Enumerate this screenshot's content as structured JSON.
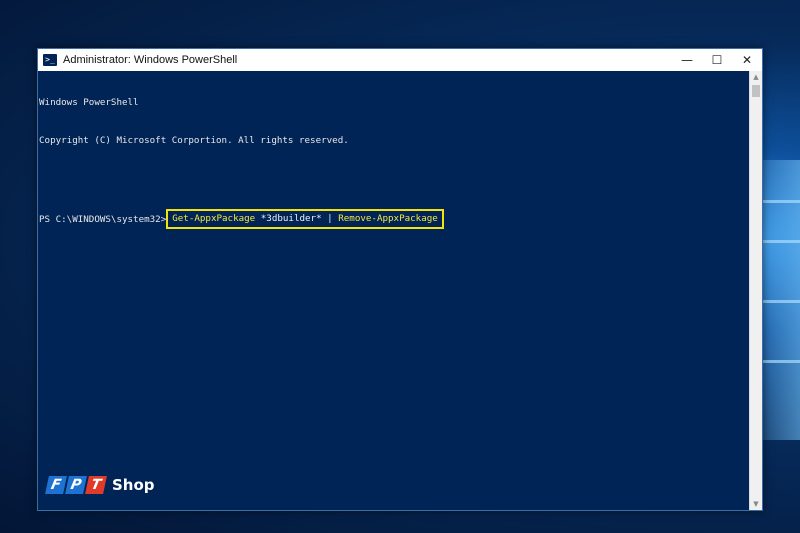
{
  "window": {
    "title": "Administrator: Windows PowerShell",
    "icon": "powershell-icon",
    "minimize_glyph": "—",
    "maximize_glyph": "☐",
    "close_glyph": "✕"
  },
  "console": {
    "line1": "Windows PowerShell",
    "line2": "Copyright (C) Microsoft Corportion. All rights reserved.",
    "prompt": "PS C:\\WINDOWS\\system32>",
    "cmd_part1": "Get-AppxPackage",
    "cmd_part2": " *3dbuilder* ",
    "cmd_part3": "|",
    "cmd_part4": " Remove-AppxPackage"
  },
  "watermark": {
    "letters": [
      "F",
      "P",
      "T"
    ],
    "word": "Shop"
  },
  "colors": {
    "console_bg": "#012456",
    "highlight_border": "#f5e20a",
    "command_text": "#f5e742"
  }
}
